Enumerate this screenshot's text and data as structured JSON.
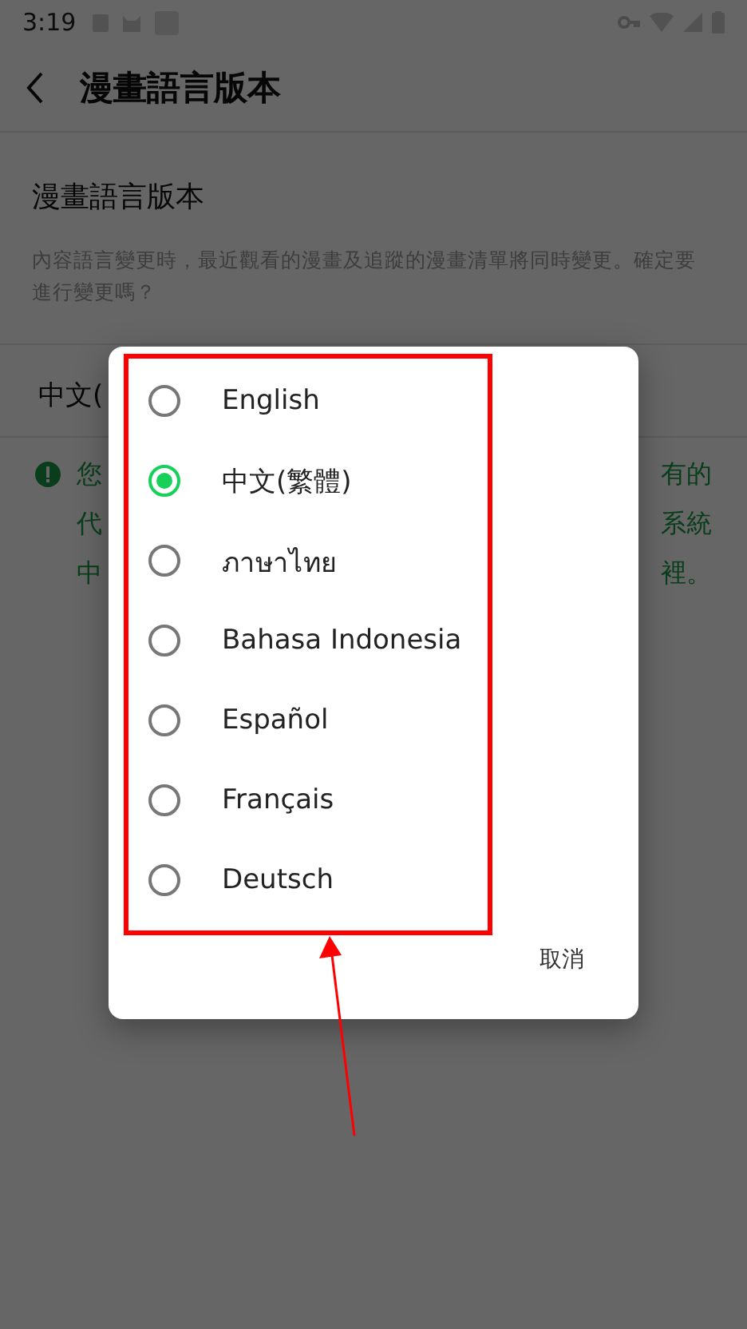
{
  "status_bar": {
    "time": "3:19"
  },
  "app_bar": {
    "title": "漫畫語言版本"
  },
  "setting": {
    "title": "漫畫語言版本",
    "description": "內容語言變更時，最近觀看的漫畫及追蹤的漫畫清單將同時變更。確定要進行變更嗎？"
  },
  "current_value": "中文(",
  "notice": {
    "lines": [
      {
        "left": "您",
        "right": "有的"
      },
      {
        "left": "代",
        "right": "系統"
      },
      {
        "left": "中",
        "right": "裡。"
      }
    ]
  },
  "dialog": {
    "options": [
      {
        "label": "English",
        "selected": false
      },
      {
        "label": "中文(繁體)",
        "selected": true
      },
      {
        "label": "ภาษาไทย",
        "selected": false
      },
      {
        "label": "Bahasa Indonesia",
        "selected": false
      },
      {
        "label": "Español",
        "selected": false
      },
      {
        "label": "Français",
        "selected": false
      },
      {
        "label": "Deutsch",
        "selected": false
      }
    ],
    "cancel": "取消"
  }
}
